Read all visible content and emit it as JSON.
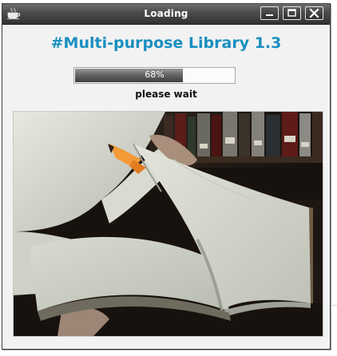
{
  "window": {
    "title": "Loading",
    "app_icon": "coffee-cup-icon",
    "controls": [
      "minimize-icon",
      "maximize-icon",
      "close-icon"
    ]
  },
  "app": {
    "title": "#Multi-purpose Library 1.3",
    "title_color": "#1a8fc0"
  },
  "progress": {
    "value": 0.68,
    "label": "68%"
  },
  "status": {
    "text": "please wait"
  },
  "splash": {
    "image": "open book held in hands in front of library shelves, with an orange bookmark ribbon"
  }
}
